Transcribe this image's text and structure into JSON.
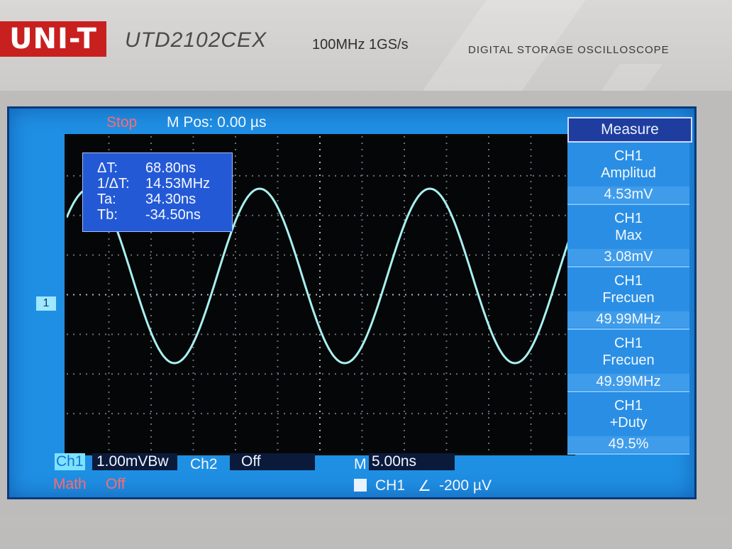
{
  "device": {
    "brand": "UNI-T",
    "model": "UTD2102CEX",
    "spec": "100MHz  1GS/s",
    "description": "DIGITAL STORAGE OSCILLOSCOPE"
  },
  "screen": {
    "status": "Stop",
    "m_pos": "M Pos: 0.00 µs",
    "trigger_marker": "1"
  },
  "cursor_readout": {
    "rows": [
      {
        "label": "ΔT:",
        "value": "68.80ns"
      },
      {
        "label": "1/ΔT:",
        "value": "14.53MHz"
      },
      {
        "label": "Ta:",
        "value": "34.30ns"
      },
      {
        "label": "Tb:",
        "value": "-34.50ns"
      }
    ]
  },
  "measure": {
    "title": "Measure",
    "items": [
      {
        "channel": "CH1",
        "name": "Amplitud",
        "value": "4.53mV"
      },
      {
        "channel": "CH1",
        "name": "Max",
        "value": "3.08mV"
      },
      {
        "channel": "CH1",
        "name": "Frecuen",
        "value": "49.99MHz"
      },
      {
        "channel": "CH1",
        "name": "Frecuen",
        "value": "49.99MHz"
      },
      {
        "channel": "CH1",
        "name": "+Duty",
        "value": "49.5%"
      }
    ]
  },
  "bottom_bar": {
    "ch1_label": "Ch1",
    "ch1_scale": "1.00mVBw",
    "ch2_label": "Ch2",
    "ch2_state": "Off",
    "time_label": "M",
    "time_scale": "5.00ns",
    "math_label": "Math",
    "math_state": "Off",
    "trigger_source": "CH1",
    "trigger_edge": "∠",
    "trigger_level": "-200 µV"
  },
  "colors": {
    "screen_blue": "#1f8fe3",
    "trace": "#a8f0f0",
    "stop_red": "#ff6a72",
    "logo_red": "#c8201f"
  },
  "waveform": {
    "type": "sine",
    "frequency_mhz": 49.99,
    "amplitude_mv": 4.53
  }
}
